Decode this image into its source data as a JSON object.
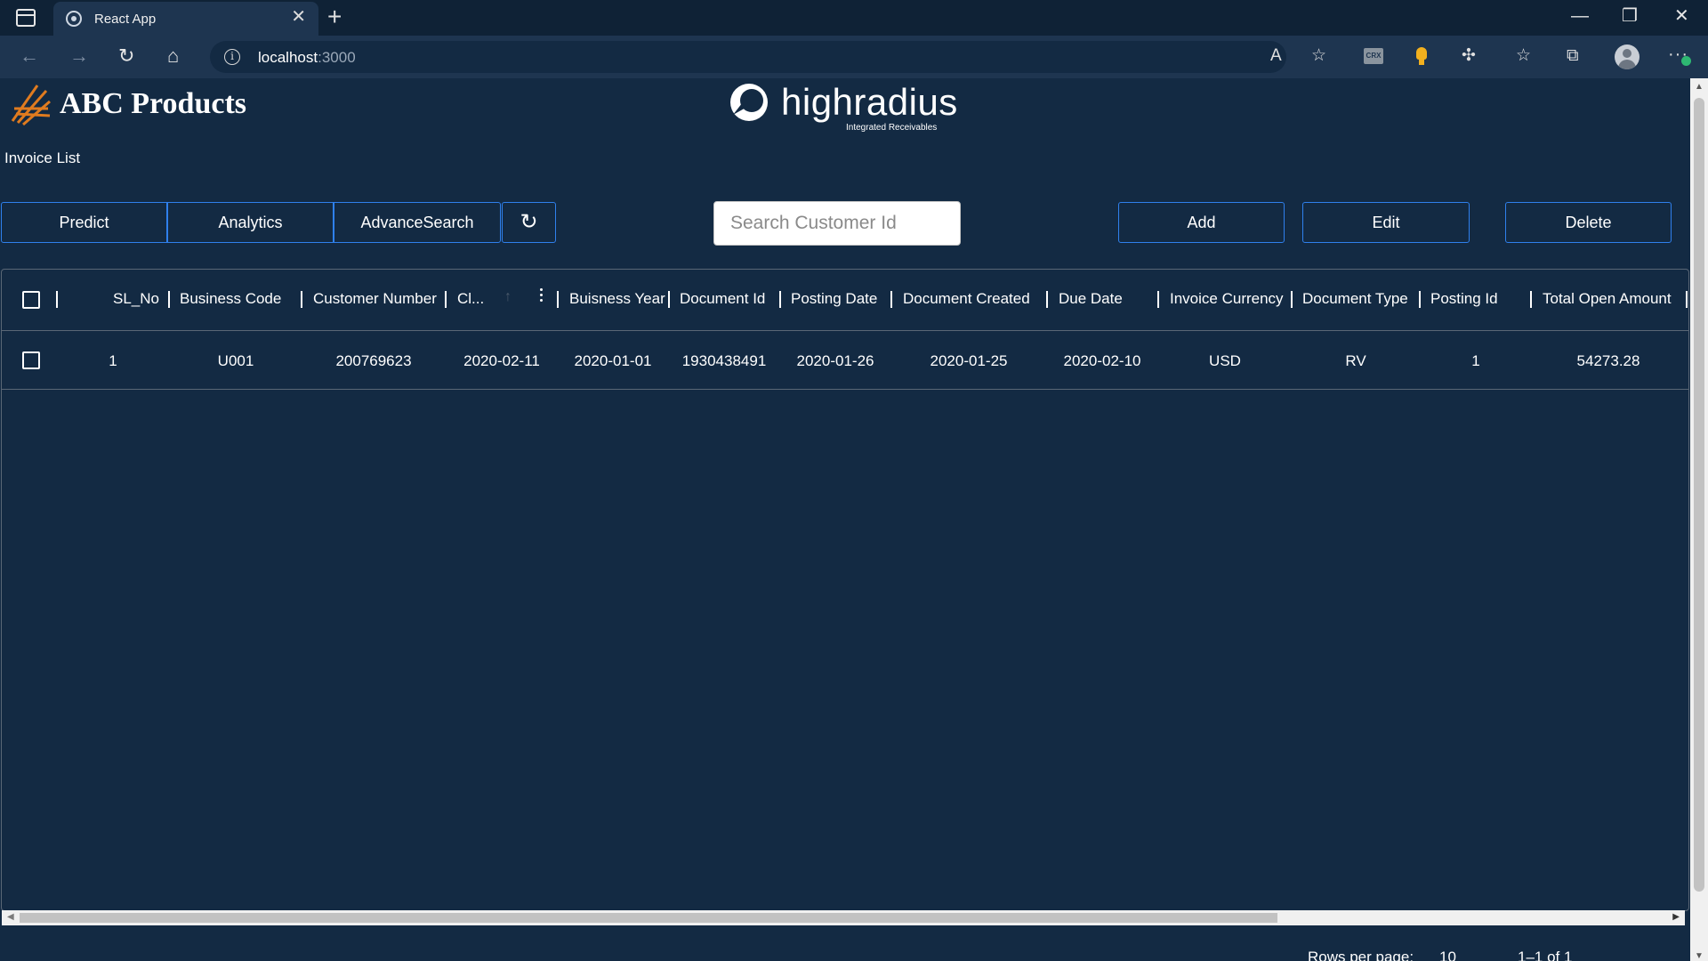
{
  "browser": {
    "tab_title": "React App",
    "url_host": "localhost",
    "url_port": ":3000"
  },
  "header": {
    "brand_name": "ABC Products",
    "partner_name": "highradius",
    "partner_tagline": "Integrated Receivables",
    "page_title": "Invoice List"
  },
  "actions": {
    "predict": "Predict",
    "analytics": "Analytics",
    "advance_search": "AdvanceSearch",
    "add": "Add",
    "edit": "Edit",
    "delete": "Delete"
  },
  "search": {
    "placeholder": "Search Customer Id",
    "value": ""
  },
  "table": {
    "columns": [
      "SL_No",
      "Business Code",
      "Customer Number",
      "Cl...",
      "Buisness Year",
      "Document Id",
      "Posting Date",
      "Document Created",
      "Due Date",
      "Invoice Currency",
      "Document Type",
      "Posting Id",
      "Total Open Amount"
    ],
    "rows": [
      [
        "1",
        "U001",
        "200769623",
        "2020-02-11",
        "2020-01-01",
        "1930438491",
        "2020-01-26",
        "2020-01-25",
        "2020-02-10",
        "USD",
        "RV",
        "1",
        "54273.28"
      ]
    ]
  },
  "pagination": {
    "rows_per_page_label": "Rows per page:",
    "rows_per_page_value": "10",
    "range": "1–1 of 1"
  },
  "colors": {
    "background": "#132a43",
    "accent": "#2f80ed"
  }
}
